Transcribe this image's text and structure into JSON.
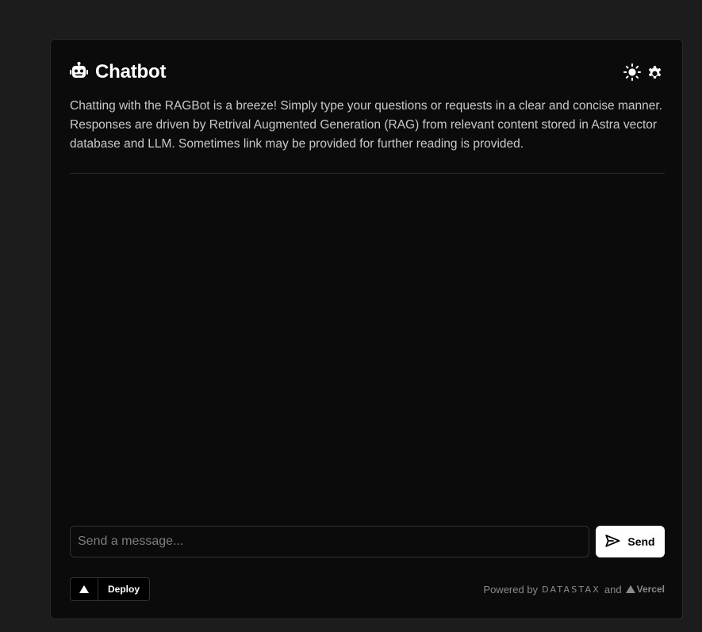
{
  "header": {
    "title": "Chatbot",
    "title_icon": "robot-icon",
    "theme_icon": "sun-icon",
    "settings_icon": "gear-icon"
  },
  "description": "Chatting with the RAGBot is a breeze! Simply type your questions or requests in a clear and concise manner. Responses are driven by Retrival Augmented Generation (RAG) from relevant content stored in Astra vector database and LLM. Sometimes link may be provided for further reading is provided.",
  "composer": {
    "placeholder": "Send a message...",
    "value": "",
    "send_label": "Send",
    "send_icon": "send-icon"
  },
  "footer": {
    "deploy_label": "Deploy",
    "deploy_icon": "triangle-icon",
    "powered_by": "Powered by",
    "datastax": "DATASTAX",
    "and": "and",
    "vercel": "Vercel"
  },
  "colors": {
    "page_bg": "#1c1c1c",
    "card_bg": "#0b0b0b",
    "border": "#2a2a2a",
    "text": "#ffffff",
    "muted_text": "#c9c9c9",
    "button_bg": "#ffffff"
  }
}
